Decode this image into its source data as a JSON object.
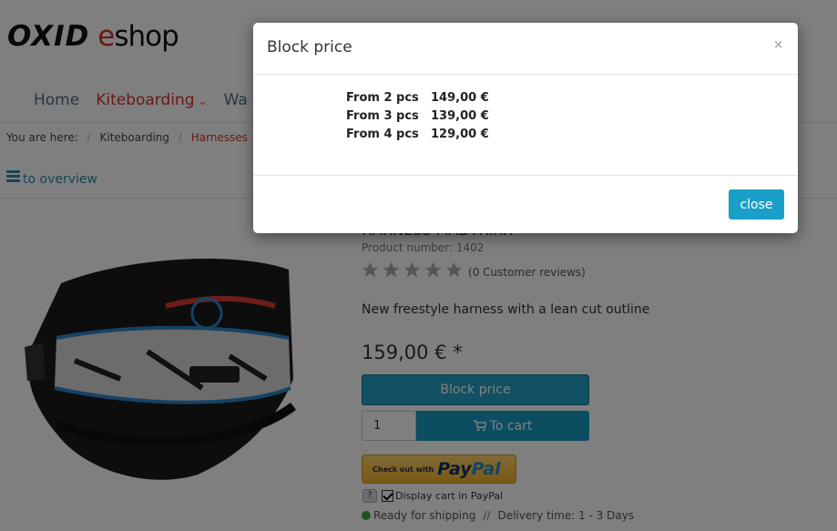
{
  "header": {
    "logo": {
      "part1": "OXID",
      "part2": "e",
      "part3": "shop"
    }
  },
  "nav": {
    "items": [
      {
        "label": "Home"
      },
      {
        "label": "Kiteboarding"
      },
      {
        "label": "Wa"
      }
    ]
  },
  "breadcrumb": {
    "prefix": "You are here:",
    "items": [
      "Kiteboarding",
      "Harnesses"
    ],
    "separator": "/"
  },
  "back_link": "to overview",
  "product": {
    "title": "HARNESS MADTRIXX",
    "number": "Product number: 1402",
    "rating_max": 5,
    "rating_value": 0,
    "reviews": "(0 Customer reviews)",
    "short_description": "New freestyle harness with a lean cut outline",
    "price": "159,00 € *",
    "block_price_button": "Block price",
    "quantity": "1",
    "cart_button": "To cart",
    "paypal": {
      "small": "Check out with",
      "brand1": "Pay",
      "brand2": "Pal"
    },
    "paypal_help": "?",
    "paypal_checkbox_label": "Display cart in PayPal",
    "shipping_status": "Ready for shipping",
    "shipping_separator": "//",
    "delivery_time": "Delivery time: 1 - 3 Days"
  },
  "modal": {
    "title": "Block price",
    "close_x": "×",
    "tiers": [
      {
        "qty": "From 2 pcs",
        "price": "149,00 €"
      },
      {
        "qty": "From 3 pcs",
        "price": "139,00 €"
      },
      {
        "qty": "From 4 pcs",
        "price": "129,00 €"
      }
    ],
    "close_button": "close"
  },
  "colors": {
    "accent": "#23a3c6",
    "brand_red": "#d2322d",
    "link": "#2c8ab1",
    "in_stock": "#3da53d"
  }
}
